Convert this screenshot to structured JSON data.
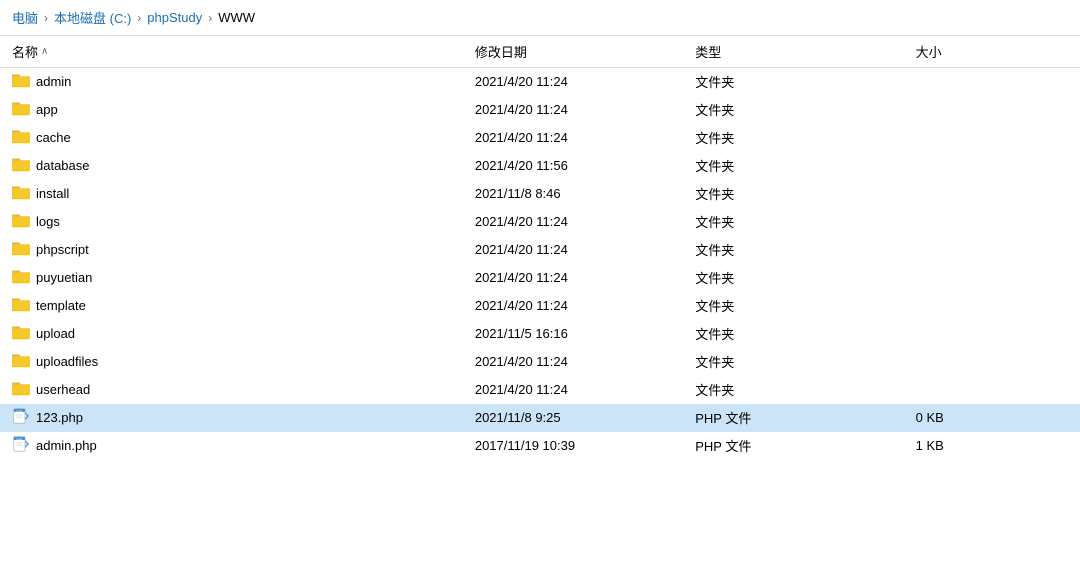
{
  "breadcrumb": {
    "items": [
      {
        "label": "电脑",
        "link": true
      },
      {
        "label": "本地磁盘 (C:)",
        "link": true
      },
      {
        "label": "phpStudy",
        "link": true
      },
      {
        "label": "WWW",
        "link": false
      }
    ],
    "separator": "›"
  },
  "table": {
    "columns": {
      "name": "名称",
      "date": "修改日期",
      "type": "类型",
      "size": "大小"
    },
    "sort_indicator": "∧",
    "rows": [
      {
        "id": 1,
        "icon": "folder",
        "name": "admin",
        "date": "2021/4/20 11:24",
        "type": "文件夹",
        "size": "",
        "selected": false
      },
      {
        "id": 2,
        "icon": "folder",
        "name": "app",
        "date": "2021/4/20 11:24",
        "type": "文件夹",
        "size": "",
        "selected": false
      },
      {
        "id": 3,
        "icon": "folder",
        "name": "cache",
        "date": "2021/4/20 11:24",
        "type": "文件夹",
        "size": "",
        "selected": false
      },
      {
        "id": 4,
        "icon": "folder",
        "name": "database",
        "date": "2021/4/20 11:56",
        "type": "文件夹",
        "size": "",
        "selected": false
      },
      {
        "id": 5,
        "icon": "folder",
        "name": "install",
        "date": "2021/11/8 8:46",
        "type": "文件夹",
        "size": "",
        "selected": false
      },
      {
        "id": 6,
        "icon": "folder",
        "name": "logs",
        "date": "2021/4/20 11:24",
        "type": "文件夹",
        "size": "",
        "selected": false
      },
      {
        "id": 7,
        "icon": "folder",
        "name": "phpscript",
        "date": "2021/4/20 11:24",
        "type": "文件夹",
        "size": "",
        "selected": false
      },
      {
        "id": 8,
        "icon": "folder",
        "name": "puyuetian",
        "date": "2021/4/20 11:24",
        "type": "文件夹",
        "size": "",
        "selected": false
      },
      {
        "id": 9,
        "icon": "folder",
        "name": "template",
        "date": "2021/4/20 11:24",
        "type": "文件夹",
        "size": "",
        "selected": false
      },
      {
        "id": 10,
        "icon": "folder",
        "name": "upload",
        "date": "2021/11/5 16:16",
        "type": "文件夹",
        "size": "",
        "selected": false
      },
      {
        "id": 11,
        "icon": "folder",
        "name": "uploadfiles",
        "date": "2021/4/20 11:24",
        "type": "文件夹",
        "size": "",
        "selected": false
      },
      {
        "id": 12,
        "icon": "folder",
        "name": "userhead",
        "date": "2021/4/20 11:24",
        "type": "文件夹",
        "size": "",
        "selected": false
      },
      {
        "id": 13,
        "icon": "php",
        "name": "123.php",
        "date": "2021/11/8 9:25",
        "type": "PHP 文件",
        "size": "0 KB",
        "selected": true
      },
      {
        "id": 14,
        "icon": "php",
        "name": "admin.php",
        "date": "2017/11/19 10:39",
        "type": "PHP 文件",
        "size": "1 KB",
        "selected": false
      }
    ]
  }
}
